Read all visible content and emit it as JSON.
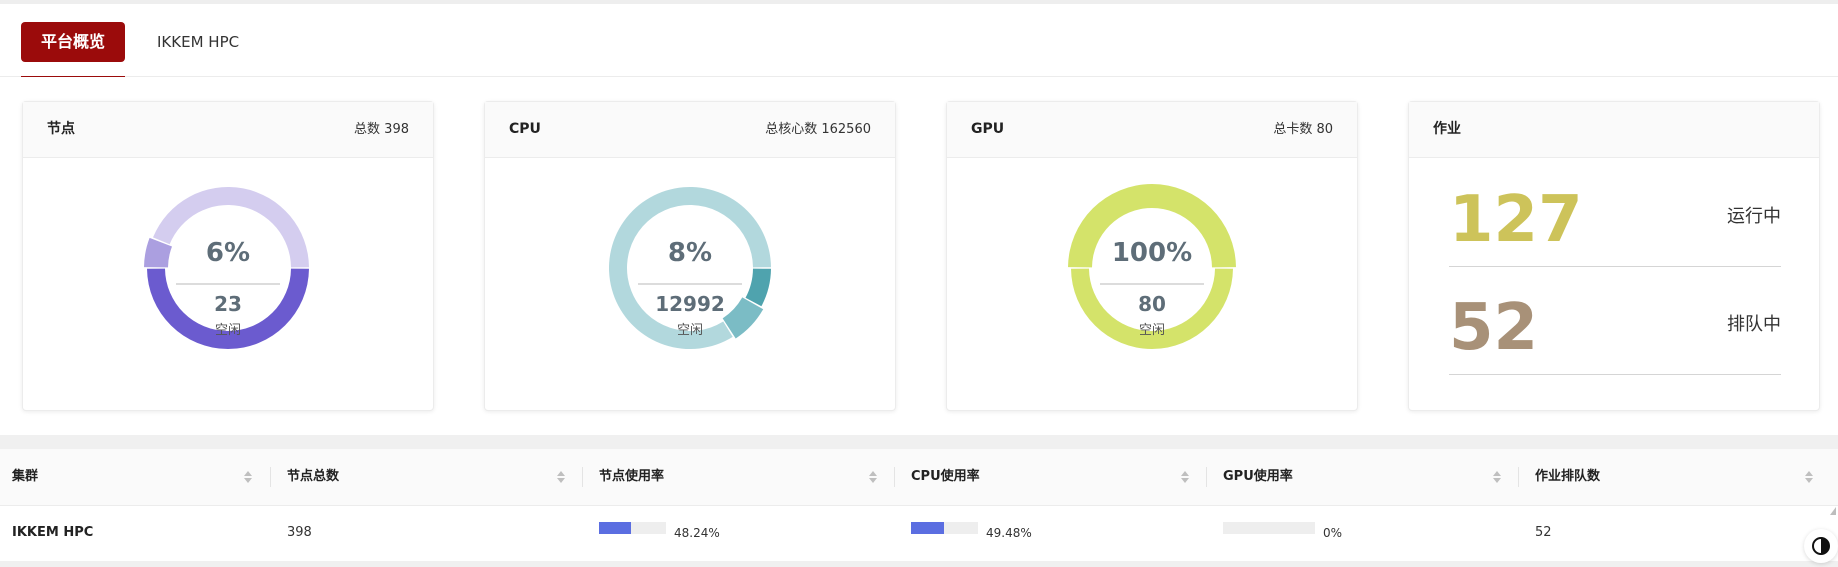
{
  "tabs": [
    {
      "label": "平台概览",
      "active": true
    },
    {
      "label": "IKKEM HPC",
      "active": false
    }
  ],
  "cards": {
    "nodes": {
      "title": "节点",
      "total": "总数 398",
      "percent": "6%",
      "count": "23",
      "status": "空闲",
      "segments": [
        {
          "value": 0.5,
          "color": "#6b5bcf"
        },
        {
          "value": 0.06,
          "color": "#ab9fe0"
        },
        {
          "value": 0.44,
          "color": "#d4cdef"
        }
      ]
    },
    "cpu": {
      "title": "CPU",
      "total": "总核心数 162560",
      "percent": "8%",
      "count": "12992",
      "status": "空闲",
      "segments": [
        {
          "value": 0.08,
          "color": "#4fa3ae"
        },
        {
          "value": 0.08,
          "color": "#7bbcc5"
        },
        {
          "value": 0.84,
          "color": "#b2d8dd"
        }
      ]
    },
    "gpu": {
      "title": "GPU",
      "total": "总卡数 80",
      "percent": "100%",
      "count": "80",
      "status": "空闲",
      "segments": [
        {
          "value": 0.5,
          "color": "#d4e36a"
        },
        {
          "value": 0.5,
          "color": "#d4e36a"
        }
      ]
    },
    "jobs": {
      "title": "作业",
      "running": {
        "count": "127",
        "label": "运行中",
        "color": "#cdc35a"
      },
      "queued": {
        "count": "52",
        "label": "排队中",
        "color": "#a89178"
      }
    }
  },
  "table": {
    "headers": [
      "集群",
      "节点总数",
      "节点使用率",
      "CPU使用率",
      "GPU使用率",
      "作业排队数"
    ],
    "row": {
      "cluster": "IKKEM HPC",
      "nodes_total": "398",
      "node_usage": "48.24%",
      "node_usage_value": 0.4824,
      "cpu_usage": "49.48%",
      "cpu_usage_value": 0.4948,
      "gpu_usage": "0%",
      "gpu_usage_value": 0,
      "queue": "52"
    }
  },
  "colors": {
    "accent": "#9b0b0b",
    "bar": "#5b6ee1"
  },
  "icons": [
    "sort-icon",
    "theme-toggle-icon",
    "scroll-up-icon"
  ]
}
